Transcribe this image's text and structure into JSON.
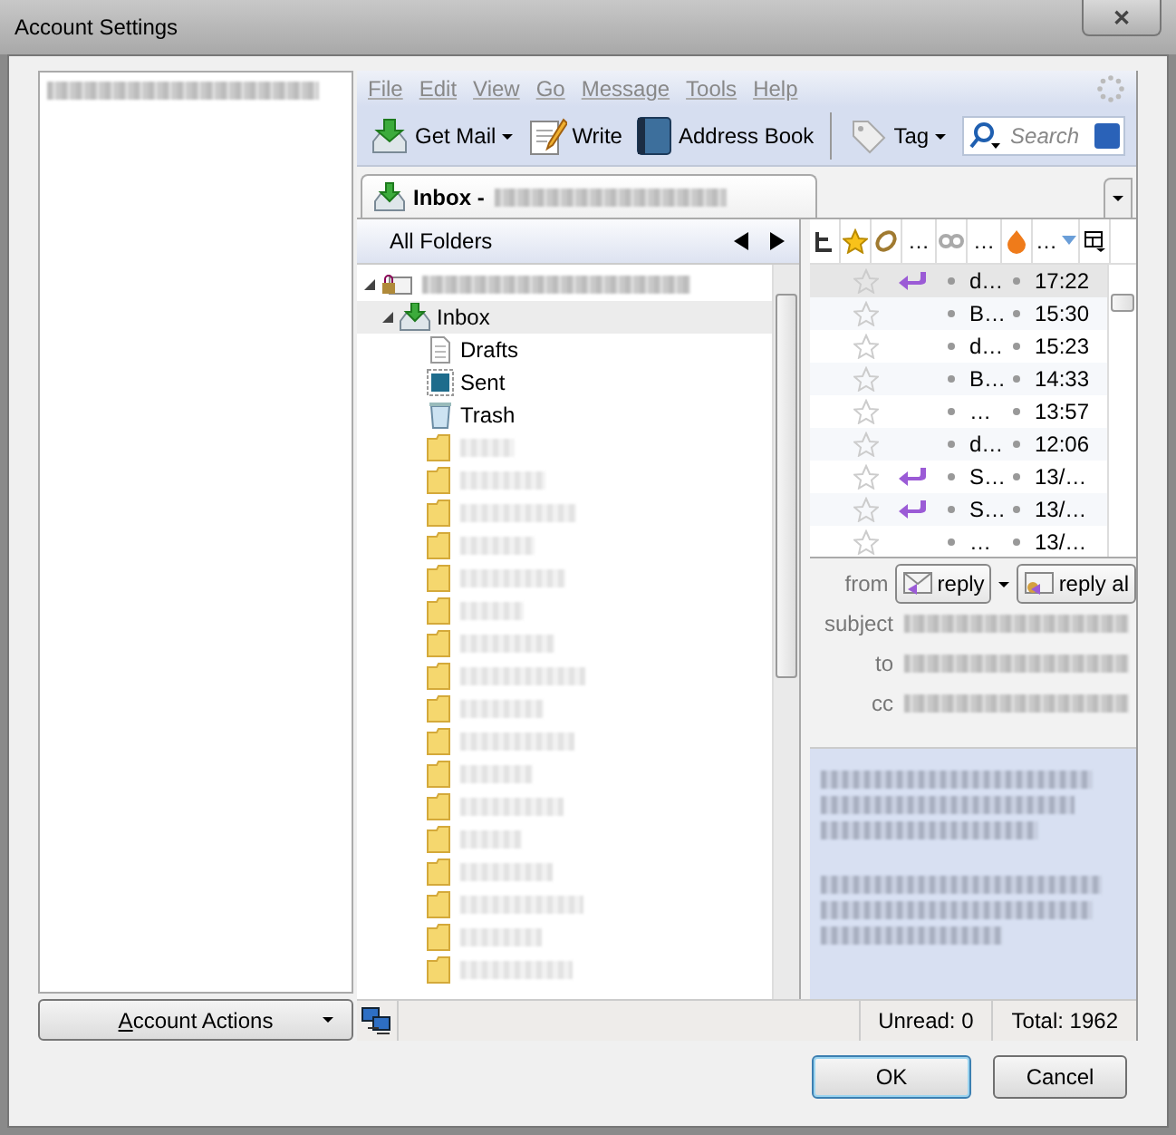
{
  "window": {
    "title": "Account Settings",
    "close_label": "✕"
  },
  "account_actions": {
    "label": "Account Actions"
  },
  "menu": [
    "File",
    "Edit",
    "View",
    "Go",
    "Message",
    "Tools",
    "Help"
  ],
  "toolbar": [
    {
      "kind": "getmail",
      "label": "Get Mail",
      "dropdown": true
    },
    {
      "kind": "write",
      "label": "Write",
      "dropdown": false
    },
    {
      "kind": "addressbook",
      "label": "Address Book",
      "dropdown": false
    },
    {
      "kind": "tag",
      "label": "Tag",
      "dropdown": true
    }
  ],
  "search": {
    "placeholder": "Search"
  },
  "tab": {
    "label": "Inbox -"
  },
  "folder_pane": {
    "title": "All Folders",
    "folders": [
      {
        "name": "Inbox",
        "kind": "inbox",
        "selected": true,
        "expanded": true,
        "children": [
          {
            "name": "Drafts",
            "kind": "drafts",
            "selected": false
          },
          {
            "name": "Sent",
            "kind": "sent",
            "selected": false
          },
          {
            "name": "Trash",
            "kind": "trash",
            "selected": false
          }
        ]
      }
    ]
  },
  "message_list": {
    "columns": [
      "…",
      "…",
      "…"
    ],
    "rows": [
      {
        "subject": "d…",
        "date": "17:22",
        "replied": true,
        "selected": true
      },
      {
        "subject": "B…",
        "date": "15:30",
        "replied": false,
        "selected": false
      },
      {
        "subject": "d…",
        "date": "15:23",
        "replied": false,
        "selected": false
      },
      {
        "subject": "B…",
        "date": "14:33",
        "replied": false,
        "selected": false
      },
      {
        "subject": "…",
        "date": "13:57",
        "replied": false,
        "selected": false
      },
      {
        "subject": "d…",
        "date": "12:06",
        "replied": false,
        "selected": false
      },
      {
        "subject": "S…",
        "date": "13/…",
        "replied": true,
        "selected": false
      },
      {
        "subject": "S…",
        "date": "13/…",
        "replied": true,
        "selected": false
      },
      {
        "subject": "…",
        "date": "13/…",
        "replied": false,
        "selected": false
      }
    ]
  },
  "header_pane": {
    "labels": [
      "from",
      "subject",
      "to",
      "cc"
    ],
    "buttons": [
      "reply",
      "reply al"
    ]
  },
  "status_bar": {
    "unread": "Unread: 0",
    "total": "Total: 1962"
  },
  "buttons": [
    {
      "label": "OK",
      "default": true
    },
    {
      "label": "Cancel",
      "default": false
    }
  ]
}
